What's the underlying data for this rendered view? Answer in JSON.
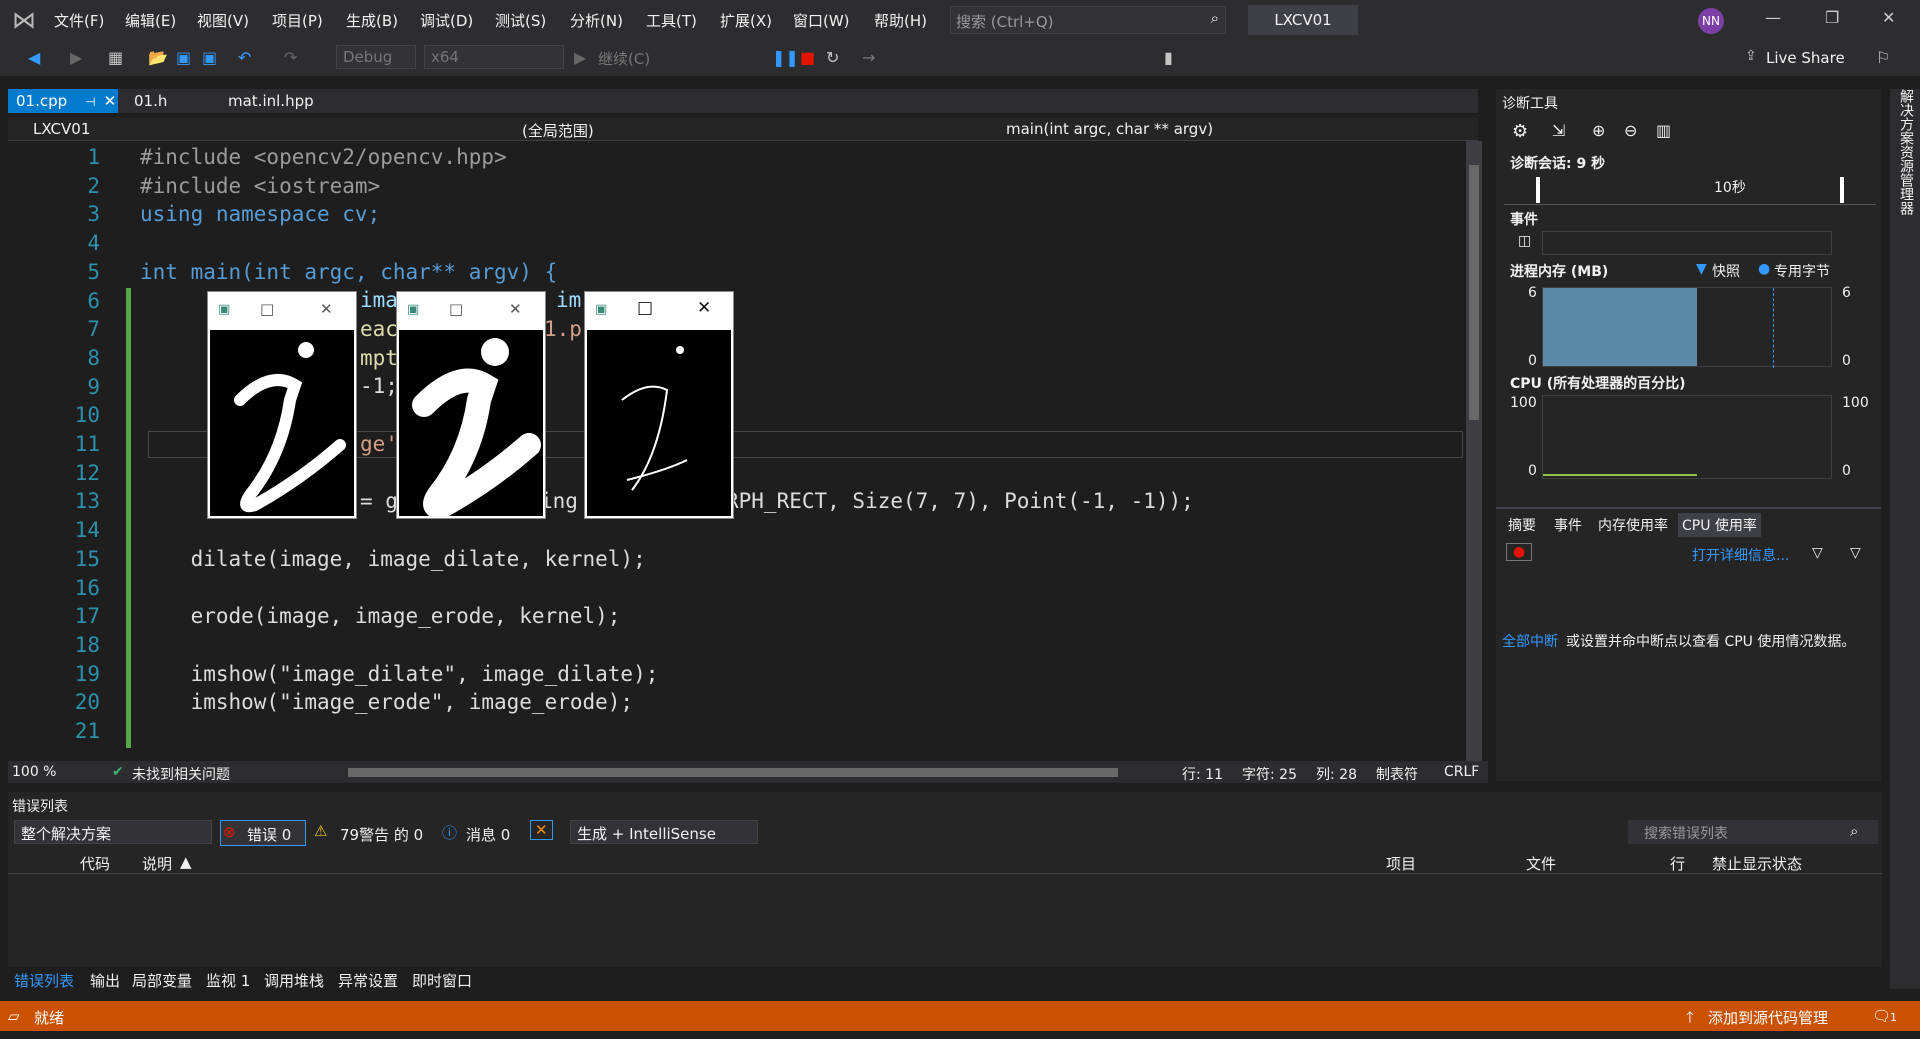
{
  "menu": [
    "文件(F)",
    "编辑(E)",
    "视图(V)",
    "项目(P)",
    "生成(B)",
    "调试(D)",
    "测试(S)",
    "分析(N)",
    "工具(T)",
    "扩展(X)",
    "窗口(W)",
    "帮助(H)"
  ],
  "search": {
    "placeholder": "搜索 (Ctrl+Q)"
  },
  "project_name": "LXCV01",
  "avatar_initials": "NN",
  "toolbar": {
    "config": "Debug",
    "platform": "x64",
    "continue": "继续(C)",
    "live_share": "Live Share"
  },
  "tabs": [
    "01.cpp",
    "01.h",
    "mat.inl.hpp"
  ],
  "navbar": {
    "project": "LXCV01",
    "scope": "(全局范围)",
    "function": "main(int argc, char ** argv)"
  },
  "code_lines": [
    {
      "n": "1",
      "text": "#include <opencv2/opencv.hpp>"
    },
    {
      "n": "2",
      "text": "#include <iostream>"
    },
    {
      "n": "3",
      "text": "using namespace cv;"
    },
    {
      "n": "4",
      "text": ""
    },
    {
      "n": "5",
      "text": "int main(int argc, char** argv) {"
    },
    {
      "n": "6",
      "text": ""
    },
    {
      "n": "7",
      "text": ""
    },
    {
      "n": "8",
      "text": ""
    },
    {
      "n": "9",
      "text": ""
    },
    {
      "n": "10",
      "text": ""
    },
    {
      "n": "11",
      "text": ""
    },
    {
      "n": "12",
      "text": ""
    },
    {
      "n": "13",
      "text": ""
    },
    {
      "n": "14",
      "text": ""
    },
    {
      "n": "15",
      "text": "    dilate(image, image_dilate, kernel);"
    },
    {
      "n": "16",
      "text": ""
    },
    {
      "n": "17",
      "text": "    erode(image, image_erode, kernel);"
    },
    {
      "n": "18",
      "text": ""
    },
    {
      "n": "19",
      "text": "    imshow(\"image_dilate\", image_dilate);"
    },
    {
      "n": "20",
      "text": "    imshow(\"image_erode\", image_erode);"
    },
    {
      "n": "21",
      "text": ""
    }
  ],
  "partial_code": {
    "l6": "ima",
    "l6b": "im",
    "l7": "eac",
    "l7b": "1.p",
    "l8": "mpt",
    "l9": "-1;",
    "l11": "ge'",
    "l13a": "= g",
    "l13b": "ing",
    "l13c": "RPH_RECT, Size(7, 7), Point(-1, -1));"
  },
  "editor_status": {
    "zoom": "100 %",
    "issues": "未找到相关问题",
    "line": "行: 11",
    "char": "字符: 25",
    "col": "列: 28",
    "tabs": "制表符",
    "eol": "CRLF"
  },
  "diagnostics": {
    "title": "诊断工具",
    "session": "诊断会话: 9 秒",
    "timeline_label": "10秒",
    "events": "事件",
    "memory_title": "进程内存 (MB)",
    "snapshot": "快照",
    "private_bytes": "专用字节",
    "mem_max": "6",
    "mem_min": "0",
    "cpu_title": "CPU (所有处理器的百分比)",
    "cpu_max": "100",
    "cpu_min": "0",
    "tabs": [
      "摘要",
      "事件",
      "内存使用率",
      "CPU 使用率"
    ],
    "open_details": "打开详细信息...",
    "break_all": "全部中断",
    "cpu_msg": "或设置并命中断点以查看 CPU 使用情况数据。"
  },
  "error_list": {
    "title": "错误列表",
    "scope": "整个解决方案",
    "errors": "错误 0",
    "warnings": "79警告 的 0",
    "messages": "消息 0",
    "build": "生成 + IntelliSense",
    "search_placeholder": "搜索错误列表",
    "columns": [
      "代码",
      "说明",
      "项目",
      "文件",
      "行",
      "禁止显示状态"
    ]
  },
  "bottom_tabs": [
    "错误列表",
    "输出",
    "局部变量",
    "监视 1",
    "调用堆栈",
    "异常设置",
    "即时窗口"
  ],
  "statusbar": {
    "ready": "就绪",
    "source_control": "添加到源代码管理",
    "notifications": "1"
  },
  "side_panel": "解决方案资源管理器",
  "colors": {
    "accent": "#007acc",
    "status": "#ca5100"
  }
}
